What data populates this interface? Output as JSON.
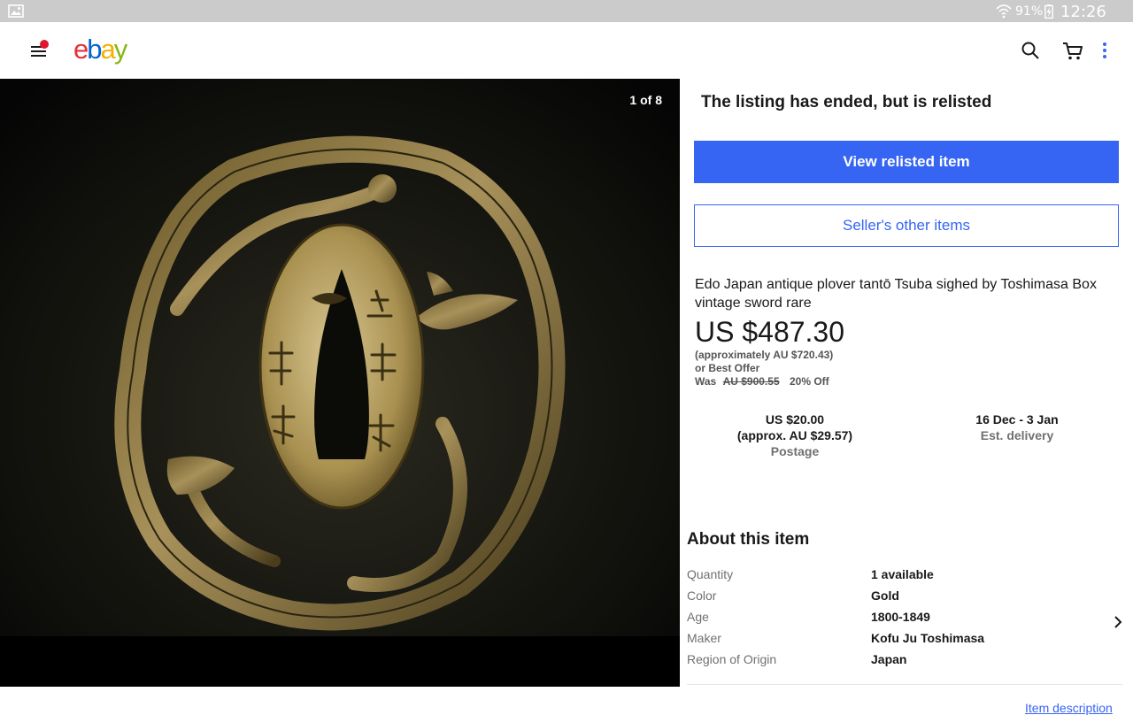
{
  "statusbar": {
    "battery_pct": "91%",
    "clock": "12:26 pm"
  },
  "header": {
    "logo_letters": [
      "e",
      "b",
      "a",
      "y"
    ],
    "colors": {
      "red": "#e53238",
      "blue": "#0064d2",
      "yellow": "#f5af02",
      "green": "#86b817"
    },
    "icons": [
      "menu-icon",
      "search-icon",
      "cart-icon",
      "more-vertical-icon"
    ]
  },
  "gallery": {
    "counter": "1 of 8"
  },
  "listing": {
    "ended_message": "The listing has ended, but is relisted",
    "view_relisted_label": "View relisted item",
    "seller_other_label": "Seller's other items",
    "title": "Edo Japan antique plover tantō Tsuba sighed by Toshimasa Box vintage sword rare",
    "price": "US $487.30",
    "approx": "(approximately AU $720.43)",
    "best_offer": "or Best Offer",
    "was_label": "Was",
    "was_price": "AU $900.55",
    "discount": "20% Off",
    "postage_value": "US $20.00",
    "postage_approx": "(approx. AU $29.57)",
    "postage_label": "Postage",
    "delivery_value": "16 Dec - 3 Jan",
    "delivery_label": "Est. delivery",
    "accent_color": "#3665f3"
  },
  "about": {
    "title": "About this item",
    "rows": [
      {
        "key": "Quantity",
        "value": "1 available"
      },
      {
        "key": "Color",
        "value": "Gold"
      },
      {
        "key": "Age",
        "value": "1800-1849"
      },
      {
        "key": "Maker",
        "value": "Kofu Ju Toshimasa"
      },
      {
        "key": "Region of Origin",
        "value": "Japan"
      }
    ],
    "item_description_link": "Item description"
  }
}
